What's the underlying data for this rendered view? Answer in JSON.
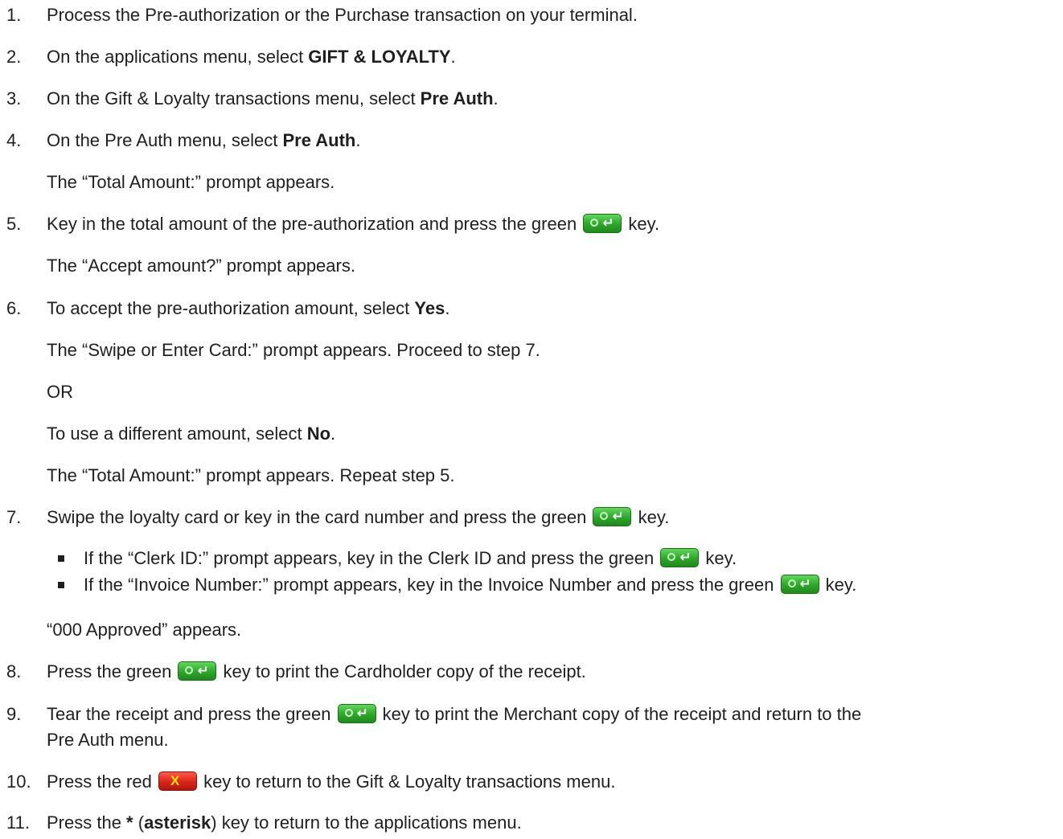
{
  "steps": {
    "s1": {
      "num": "1.",
      "text": "Process the Pre-authorization or the Purchase transaction on your terminal."
    },
    "s2": {
      "num": "2.",
      "pre": "On the applications menu, select ",
      "bold": "GIFT & LOYALTY",
      "post": "."
    },
    "s3": {
      "num": "3.",
      "pre": "On the Gift & Loyalty transactions menu, select ",
      "bold": "Pre Auth",
      "post": "."
    },
    "s4": {
      "num": "4.",
      "pre": "On the Pre Auth menu, select ",
      "bold": "Pre Auth",
      "post": ".",
      "note": "The “Total Amount:” prompt appears."
    },
    "s5": {
      "num": "5.",
      "pre": "Key in the total amount of the pre-authorization and press the green ",
      "post": " key.",
      "note": "The “Accept amount?” prompt appears."
    },
    "s6": {
      "num": "6.",
      "pre": "To accept the pre-authorization amount, select ",
      "bold": "Yes",
      "post": ".",
      "note1": "The “Swipe or Enter Card:” prompt appears. Proceed to step 7.",
      "or": "OR",
      "alt_pre": "To use a different amount, select ",
      "alt_bold": "No",
      "alt_post": ".",
      "note2": "The “Total Amount:” prompt appears. Repeat step 5."
    },
    "s7": {
      "num": "7.",
      "pre": "Swipe the loyalty card or key in the card number and press the green ",
      "post": " key.",
      "bullets": [
        {
          "pre": "If the “Clerk ID:” prompt appears, key in the Clerk ID and press the green ",
          "post": " key."
        },
        {
          "pre": "If the “Invoice Number:” prompt appears, key in the Invoice Number and press the green ",
          "post": " key."
        }
      ],
      "note": "“000 Approved” appears."
    },
    "s8": {
      "num": "8.",
      "pre": "Press the green ",
      "post": " key to print the Cardholder copy of the receipt."
    },
    "s9": {
      "num": "9.",
      "pre": "Tear the receipt and press the green ",
      "post": " key to print the Merchant copy of the receipt and return to the",
      "cont": "Pre Auth menu."
    },
    "s10": {
      "num": "10.",
      "pre": "Press the red ",
      "post": " key to return to the Gift & Loyalty transactions menu."
    },
    "s11": {
      "num": "11.",
      "pre": "Press the ",
      "bold1": "*",
      "mid1": " (",
      "bold2": "asterisk",
      "post": ") key to return to the applications menu."
    }
  },
  "icons": {
    "enter_key": "green-enter-key-icon",
    "cancel_key": "red-cancel-key-icon"
  },
  "colors": {
    "text": "#1f1f1f",
    "green_key": "#2ea52b",
    "red_key": "#d8241a"
  }
}
